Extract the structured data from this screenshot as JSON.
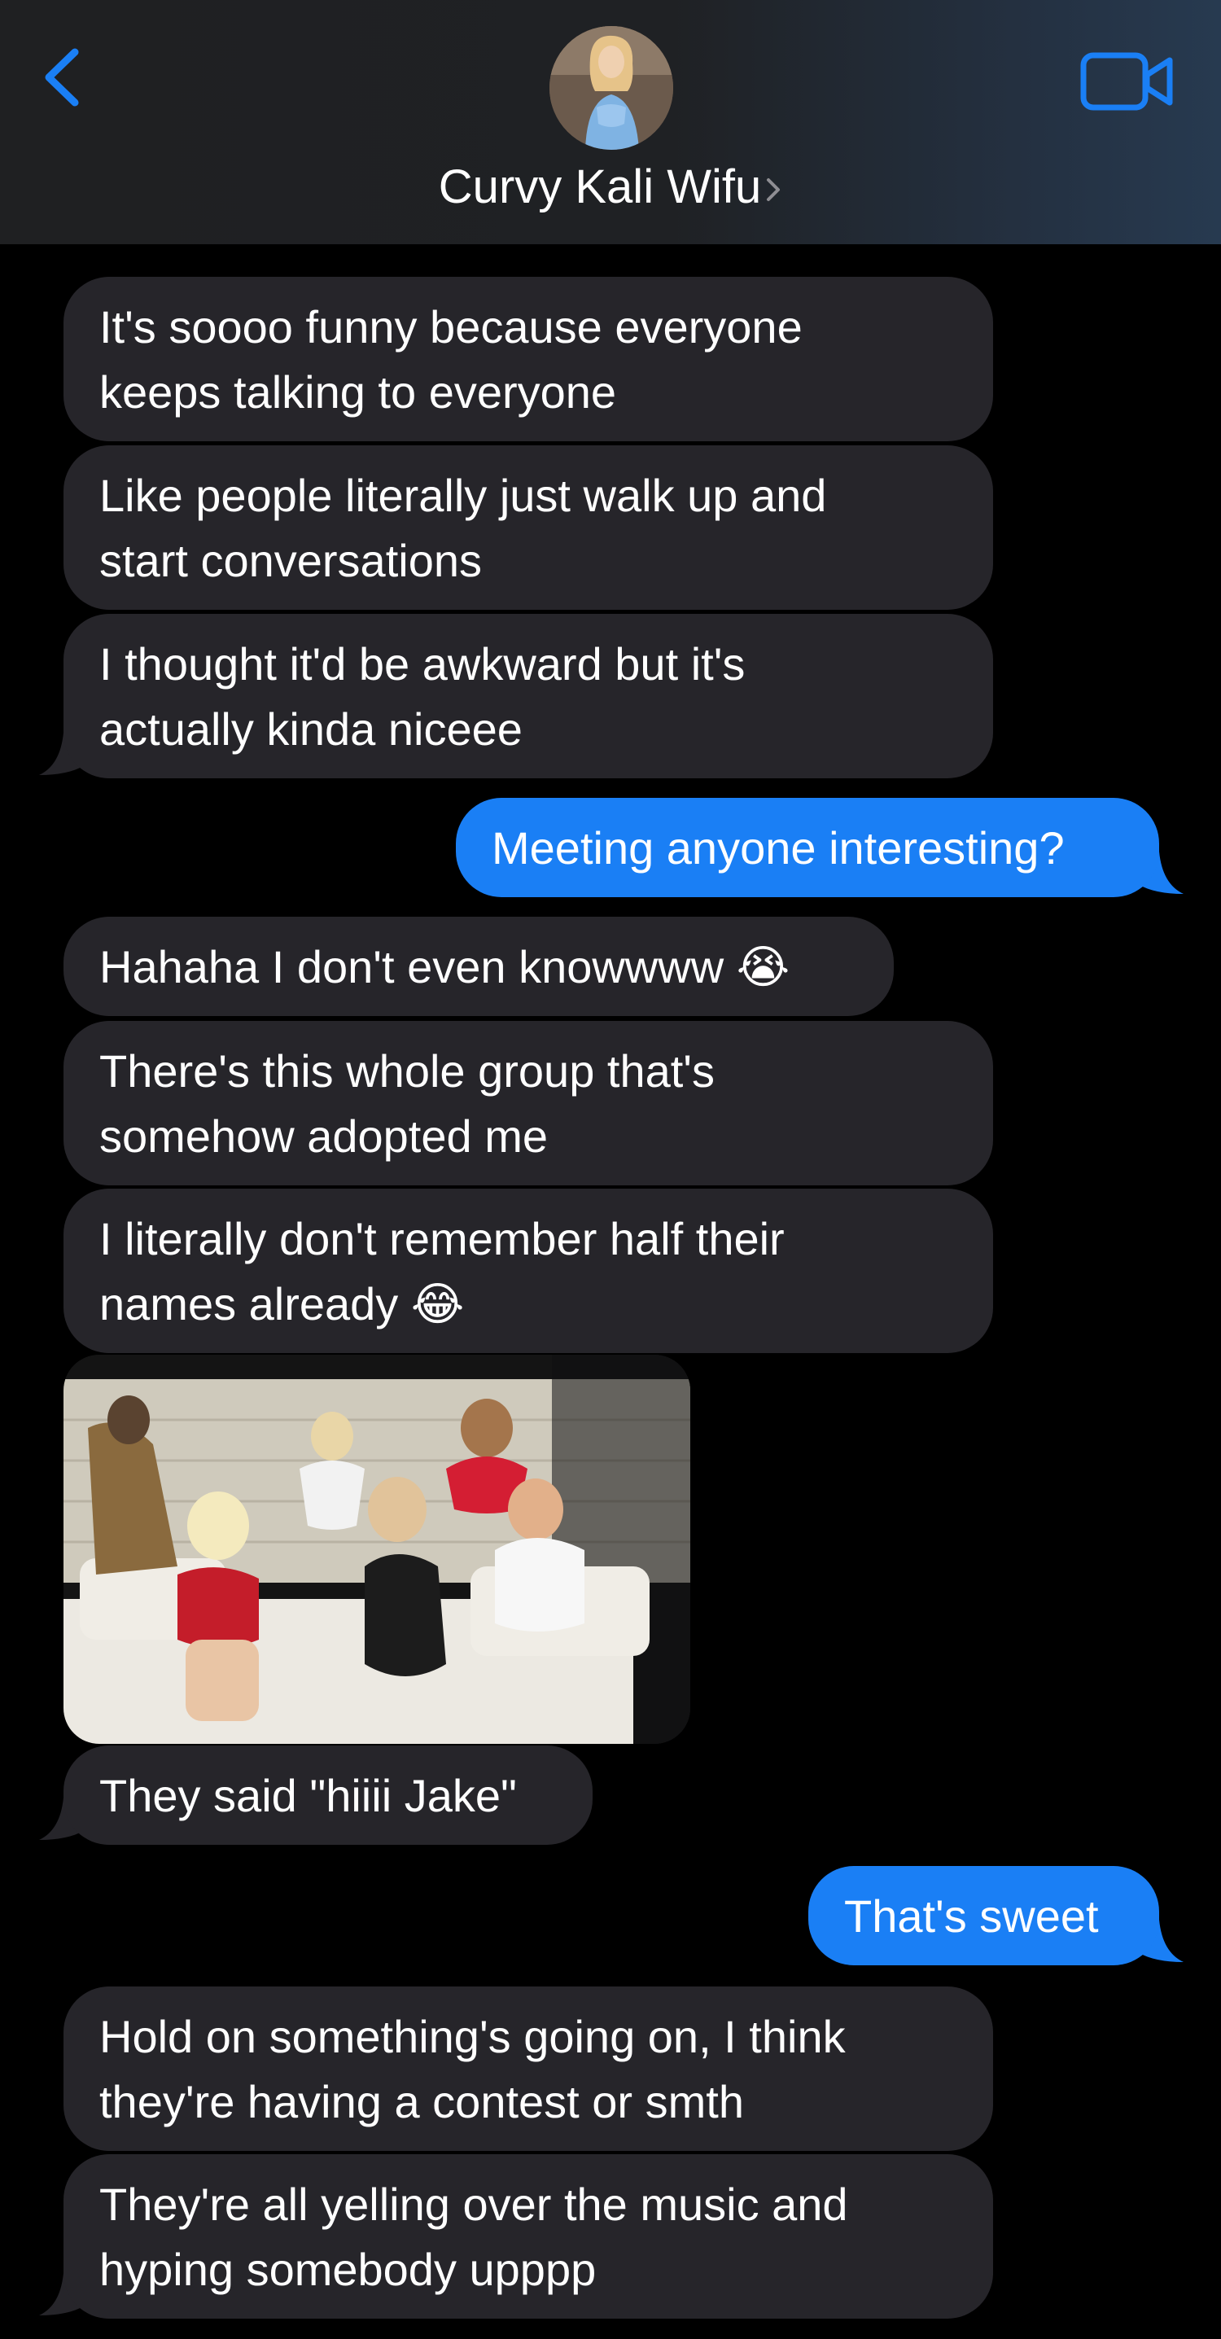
{
  "header": {
    "contact_name": "Curvy Kali Wifu",
    "back_icon": "chevron-left-icon",
    "video_icon": "video-camera-icon",
    "accent_color": "#1a7ff5"
  },
  "messages": [
    {
      "side": "received",
      "text": [
        "It's soooo funny because everyone",
        "keeps talking to everyone"
      ]
    },
    {
      "side": "received",
      "text": [
        "Like people literally just walk up and",
        "start conversations"
      ]
    },
    {
      "side": "received",
      "text": [
        "I thought it'd be awkward but it's",
        "actually kinda niceee"
      ]
    },
    {
      "side": "sent",
      "text": [
        "Meeting anyone interesting?"
      ]
    },
    {
      "side": "received",
      "text": [
        "Hahaha I don't even knowwww 😭"
      ]
    },
    {
      "side": "received",
      "text": [
        "There's this whole group that's",
        "somehow adopted me"
      ]
    },
    {
      "side": "received",
      "text": [
        "I literally don't remember half their",
        "names already 😂"
      ]
    },
    {
      "side": "received",
      "type": "photo"
    },
    {
      "side": "received",
      "text": [
        "They said \"hiiii Jake\""
      ]
    },
    {
      "side": "sent",
      "text": [
        "That's sweet"
      ]
    },
    {
      "side": "received",
      "text": [
        "Hold on something's going on, I think",
        "they're having a contest or smth"
      ]
    },
    {
      "side": "received",
      "text": [
        "They're all yelling over the music and",
        "hyping somebody upppp"
      ]
    }
  ],
  "colors": {
    "received_bubble": "#26252a",
    "sent_bubble": "#1a7ff5",
    "background": "#000000"
  }
}
